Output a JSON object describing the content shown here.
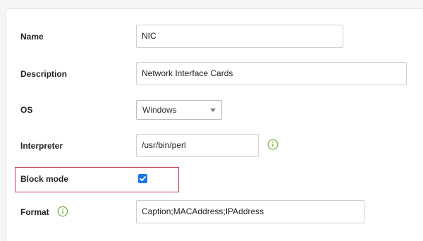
{
  "form": {
    "name": {
      "label": "Name",
      "value": "NIC"
    },
    "description": {
      "label": "Description",
      "value": "Network Interface Cards"
    },
    "os": {
      "label": "OS",
      "selected": "Windows"
    },
    "interpreter": {
      "label": "Interpreter",
      "value": "/usr/bin/perl",
      "info_icon": "info-circle-icon"
    },
    "block_mode": {
      "label": "Block mode",
      "checked": true
    },
    "format": {
      "label": "Format",
      "value": "Caption;MACAddress;IPAddress",
      "info_icon": "info-circle-icon"
    }
  },
  "colors": {
    "accent": "#1a73e8",
    "info_icon": "#7cb342",
    "highlight_border": "#c9424c"
  }
}
